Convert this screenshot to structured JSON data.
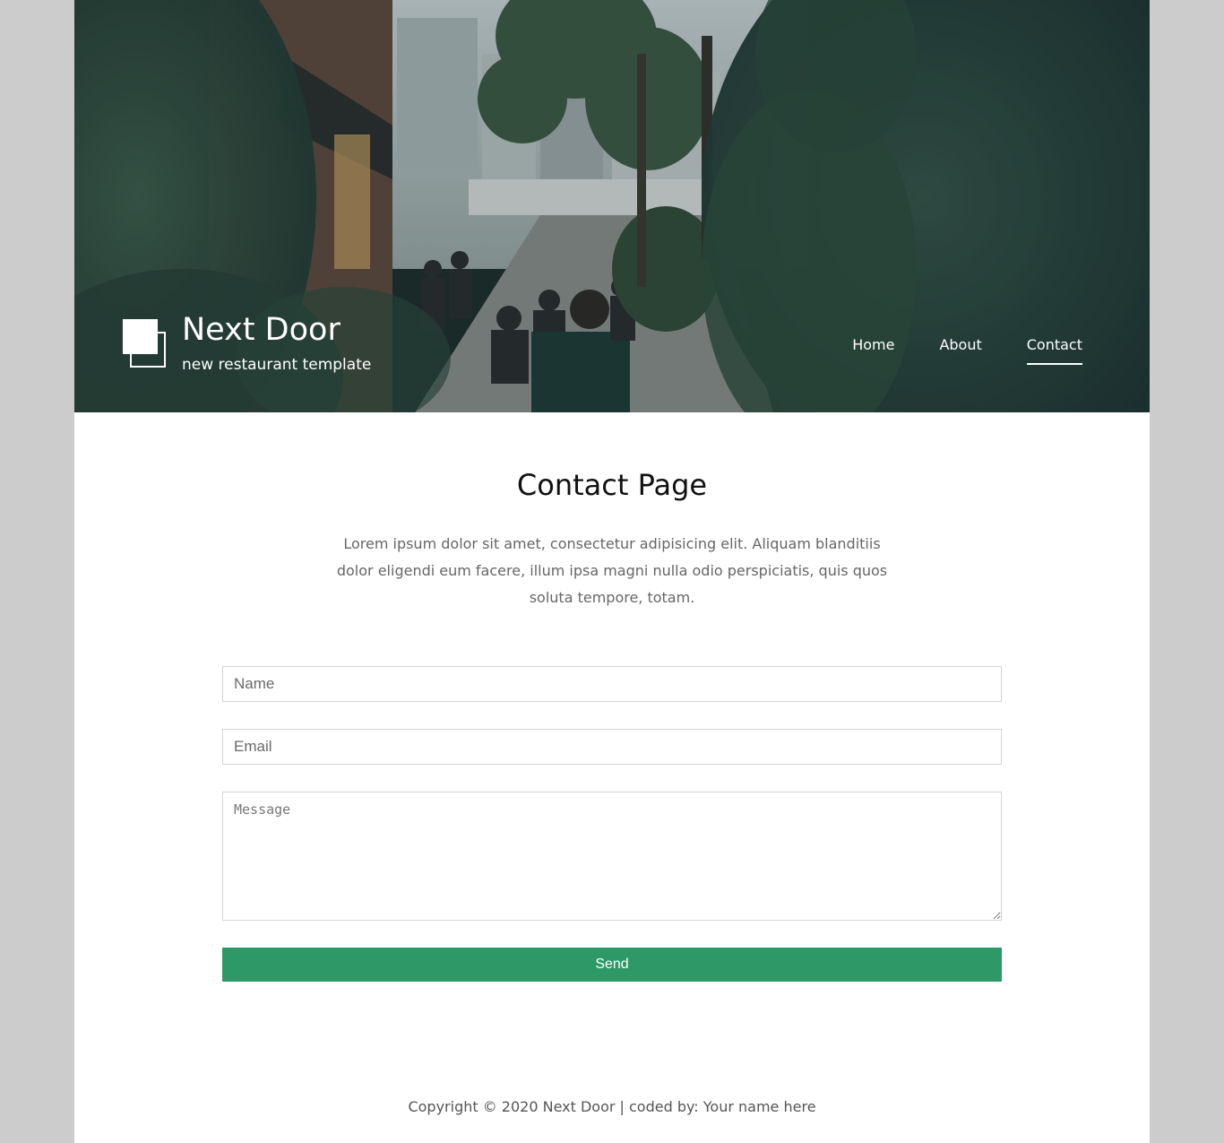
{
  "header": {
    "brand_title": "Next Door",
    "brand_tagline": "new restaurant template",
    "nav": [
      {
        "label": "Home",
        "active": false
      },
      {
        "label": "About",
        "active": false
      },
      {
        "label": "Contact",
        "active": true
      }
    ],
    "hero_image": "street-cafe-photo"
  },
  "main": {
    "title": "Contact Page",
    "intro": "Lorem ipsum dolor sit amet, consectetur adipisicing elit. Aliquam blanditiis dolor eligendi eum facere, illum ipsa magni nulla odio perspiciatis, quis quos soluta tempore, totam.",
    "form": {
      "name_placeholder": "Name",
      "email_placeholder": "Email",
      "message_placeholder": "Message",
      "send_label": "Send"
    }
  },
  "footer": {
    "copyright": "Copyright © 2020 Next Door | coded by: Your name here"
  },
  "colors": {
    "accent": "#2e9966",
    "outer_background": "#cccccc",
    "page_background": "#ffffff"
  }
}
